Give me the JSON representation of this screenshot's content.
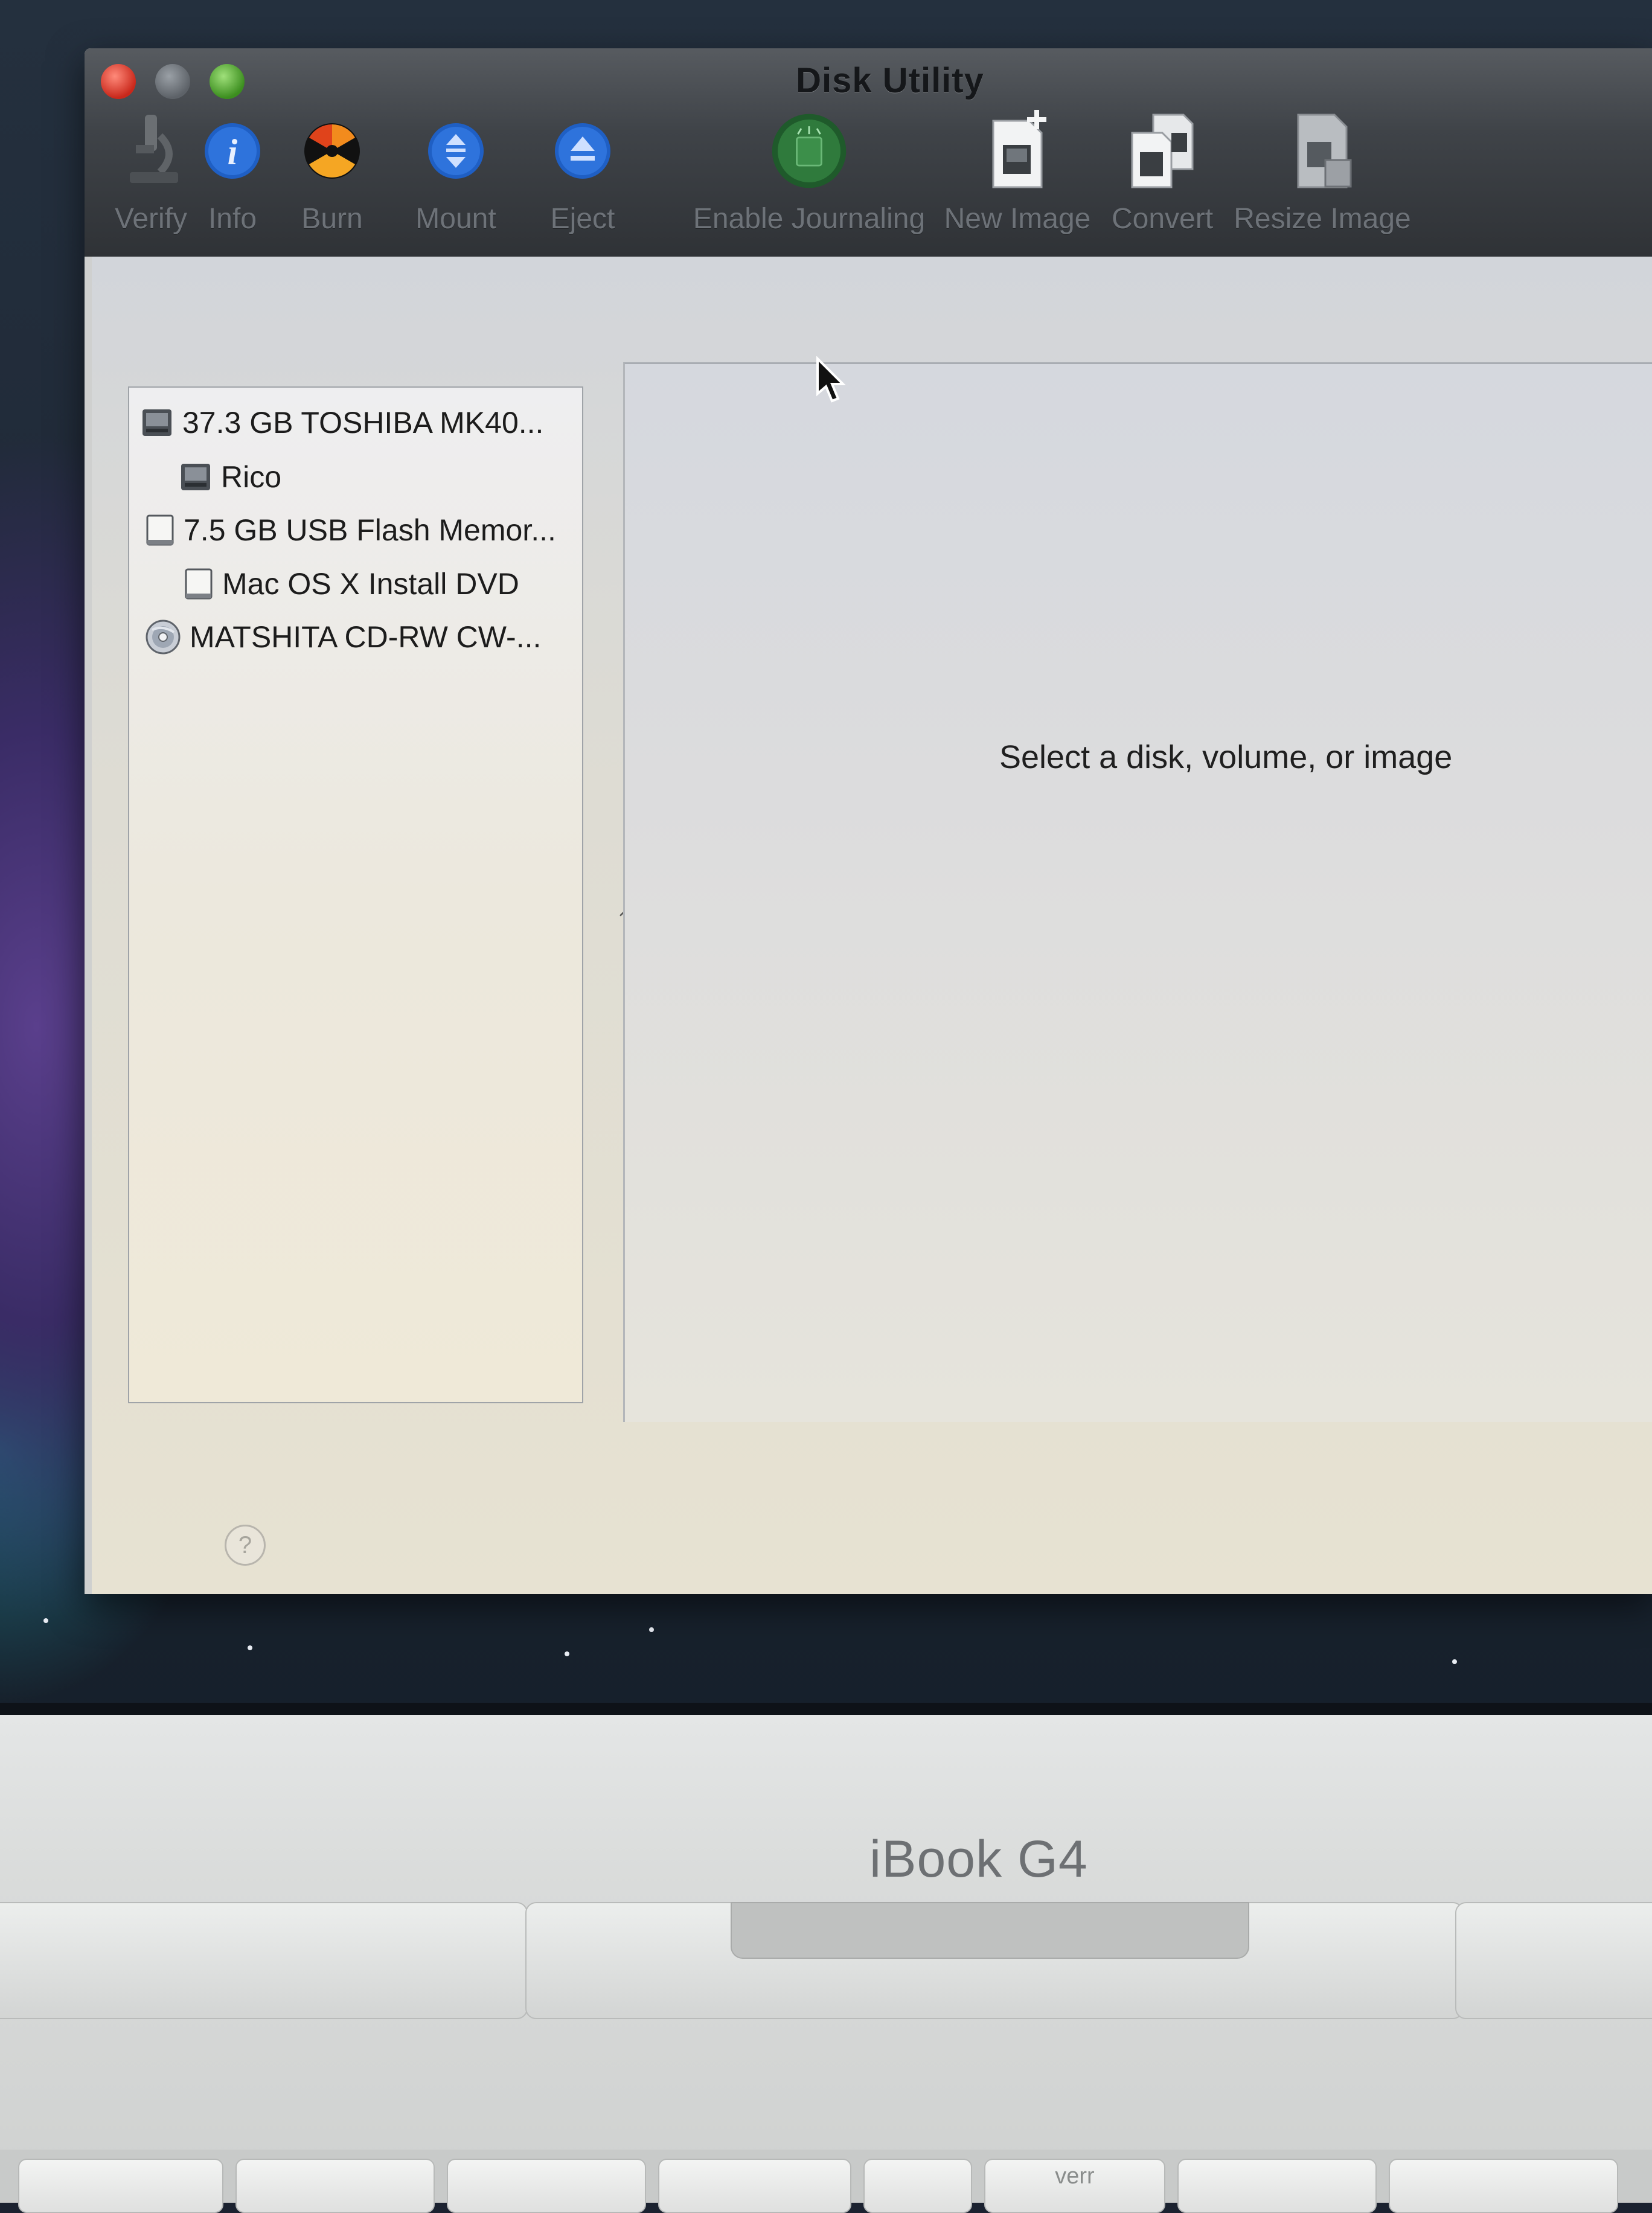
{
  "window": {
    "title": "Disk Utility"
  },
  "toolbar": {
    "items": [
      {
        "label": "Verify",
        "icon": "microscope-icon"
      },
      {
        "label": "Info",
        "icon": "info-icon"
      },
      {
        "label": "Burn",
        "icon": "burn-radiation-icon"
      },
      {
        "label": "Mount",
        "icon": "mount-icon"
      },
      {
        "label": "Eject",
        "icon": "eject-icon"
      },
      {
        "label": "Enable Journaling",
        "icon": "journaling-icon"
      },
      {
        "label": "New Image",
        "icon": "new-image-icon"
      },
      {
        "label": "Convert",
        "icon": "convert-icon"
      },
      {
        "label": "Resize Image",
        "icon": "resize-image-icon"
      }
    ]
  },
  "sidebar": {
    "items": [
      {
        "label": "37.3 GB TOSHIBA MK40...",
        "icon": "hard-disk-icon",
        "level": 0
      },
      {
        "label": "Rico",
        "icon": "volume-icon",
        "level": 1
      },
      {
        "label": "7.5 GB USB Flash Memor...",
        "icon": "usb-disk-icon",
        "level": 0
      },
      {
        "label": "Mac OS X Install DVD",
        "icon": "usb-volume-icon",
        "level": 1
      },
      {
        "label": "MATSHITA CD-RW CW-...",
        "icon": "optical-drive-icon",
        "level": 0
      }
    ]
  },
  "detail": {
    "empty_message": "Select a disk, volume, or image"
  },
  "help": {
    "label": "?"
  },
  "laptop": {
    "brand": "iBook G4",
    "key_label": "verr"
  },
  "colors": {
    "titlebar": "#3f4348",
    "close": "#c9281b",
    "zoom": "#3c8e1f",
    "info_blue": "#1f5fc4"
  }
}
